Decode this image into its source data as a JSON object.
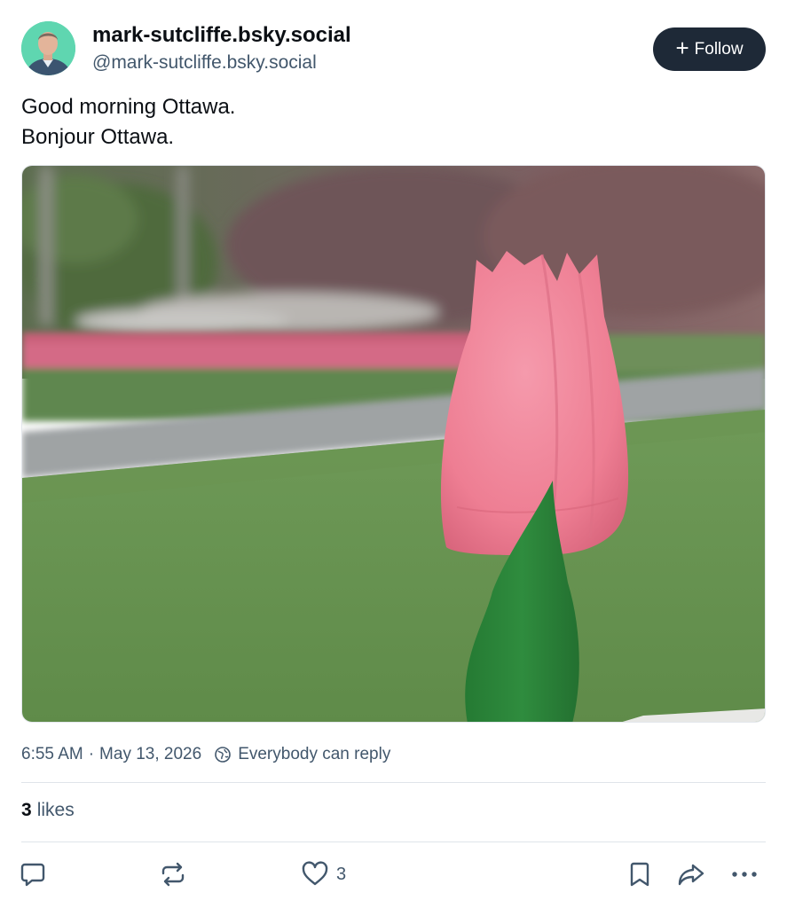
{
  "author": {
    "display_name": "mark-sutcliffe.bsky.social",
    "handle": "@mark-sutcliffe.bsky.social"
  },
  "follow_button": {
    "label": "Follow"
  },
  "post": {
    "lines": [
      "Good morning Ottawa.",
      "Bonjour Ottawa."
    ]
  },
  "meta": {
    "time": "6:55 AM",
    "separator": "·",
    "date": "May 13, 2026",
    "reply_setting": "Everybody can reply"
  },
  "stats": {
    "likes_count": "3",
    "likes_label": "likes"
  },
  "actions": {
    "reply": {
      "icon": "reply-icon"
    },
    "repost": {
      "icon": "repost-icon"
    },
    "like": {
      "icon": "heart-icon",
      "count": "3"
    },
    "bookmark": {
      "icon": "bookmark-icon"
    },
    "share": {
      "icon": "share-icon"
    },
    "more": {
      "icon": "more-icon"
    }
  },
  "colors": {
    "follow_bg": "#1e2937",
    "muted_text": "#42576c",
    "tulip_pink": "#f07e95",
    "leaf_green": "#2e8a3c"
  }
}
